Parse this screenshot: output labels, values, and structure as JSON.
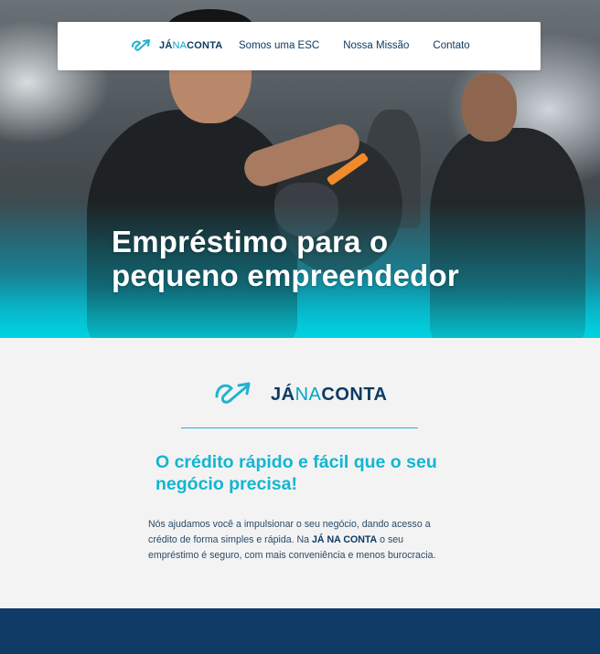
{
  "nav": {
    "logo": {
      "ja": "JÁ",
      "na": "NA",
      "conta": "CONTA"
    },
    "links": [
      {
        "label": "Somos uma ESC"
      },
      {
        "label": "Nossa Missão"
      },
      {
        "label": "Contato"
      }
    ]
  },
  "hero": {
    "title_line1": "Empréstimo para o",
    "title_line2": "pequeno empreendedor"
  },
  "content": {
    "logo": {
      "ja": "JÁ",
      "na": "NA",
      "conta": "CONTA"
    },
    "headline_line1": "O crédito rápido e fácil que o seu",
    "headline_line2": "negócio precisa!",
    "body_part1": "Nós ajudamos você a impulsionar o seu negócio, dando acesso a crédito de forma simples e rápida. Na ",
    "body_brand": "JÁ NA CONTA",
    "body_part2": " o seu empréstimo é seguro, com mais conveniência e menos burocracia."
  },
  "colors": {
    "brand_dark": "#0e3b63",
    "brand_cyan": "#12b6d0",
    "footer": "#0f3b66"
  }
}
